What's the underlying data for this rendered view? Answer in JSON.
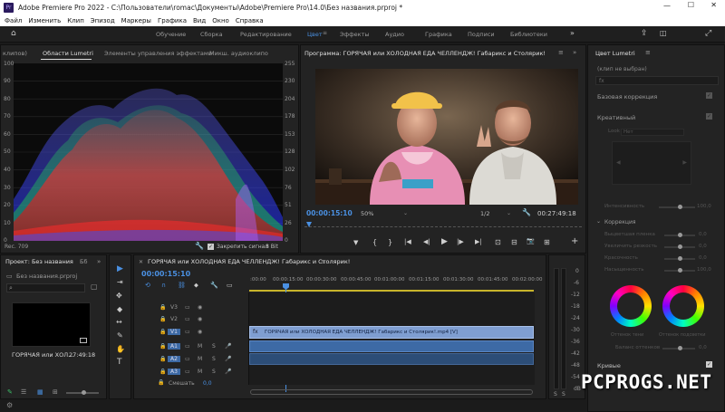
{
  "window": {
    "title": "Adobe Premiere Pro 2022 - C:\\Пользователи\\romac\\Документы\\Adobe\\Premiere Pro\\14.0\\Без названия.prproj *",
    "controls": [
      "—",
      "☐",
      "✕"
    ]
  },
  "menu": [
    "Файл",
    "Изменить",
    "Клип",
    "Эпизод",
    "Маркеры",
    "Графика",
    "Вид",
    "Окно",
    "Справка"
  ],
  "workspaces": {
    "items": [
      "Обучение",
      "Сборка",
      "Редактирование",
      "Цвет",
      "Эффекты",
      "Аудио",
      "Графика",
      "Подписи",
      "Библиотеки"
    ],
    "active": "Цвет"
  },
  "scopes": {
    "tabs": [
      "клипов)",
      "Области Lumetri",
      "Элементы управления эффектами",
      "Микш. аудиоклипо"
    ],
    "left_scale": [
      "100",
      "90",
      "80",
      "70",
      "60",
      "50",
      "40",
      "30",
      "20",
      "10",
      "0"
    ],
    "right_scale": [
      "255",
      "230",
      "204",
      "178",
      "153",
      "128",
      "102",
      "76",
      "51",
      "26",
      "0"
    ],
    "footer_left": "Rec. 709",
    "clamp_label": "Закрепить сигнал",
    "bit_depth": "8 Bit"
  },
  "program": {
    "title": "Программа: ГОРЯЧАЯ или ХОЛОДНАЯ ЕДА ЧЕЛЛЕНДЖ! Габарикс и Столярик!",
    "timecode": "00:00:15:10",
    "zoom": "50%",
    "resolution": "1/2",
    "duration": "00:27:49:18",
    "buttons": [
      "▼",
      "{",
      "}",
      "|◀",
      "◀|",
      "▶",
      "|▶",
      "▶|",
      "⊡",
      "⊟",
      "📷",
      "⊞",
      "+"
    ]
  },
  "project": {
    "tab": "Проект: Без названия",
    "tab2": "Бб",
    "file": "Без названия.prproj",
    "clip_name": "ГОРЯЧАЯ или ХОЛ...",
    "clip_duration": "27:49:18"
  },
  "tools": [
    "▶",
    "⇥",
    "✥",
    "◆",
    "↔",
    "✎",
    "✋",
    "T"
  ],
  "timeline": {
    "title": "ГОРЯЧАЯ или ХОЛОДНАЯ ЕДА ЧЕЛЛЕНДЖ! Габарикс и Столярик!",
    "timecode": "00:00:15:10",
    "ruler": [
      ":00:00",
      "00:00:15:00",
      "00:00:30:00",
      "00:00:45:00",
      "00:01:00:00",
      "00:01:15:00",
      "00:01:30:00",
      "00:01:45:00",
      "00:02:00:00"
    ],
    "video_tracks": [
      "V3",
      "V2",
      "V1"
    ],
    "audio_tracks": [
      "A1",
      "A2",
      "A3"
    ],
    "mix_label": "Смешать",
    "mix_value": "0,0",
    "clip_label": "ГОРЯЧАЯ или ХОЛОДНАЯ ЕДА ЧЕЛЛЕНДЖ! Габарикс и Столярик!.mp4 [V]"
  },
  "meter": {
    "scale": [
      "0",
      "-6",
      "-12",
      "-18",
      "-24",
      "-30",
      "-36",
      "-42",
      "-48",
      "-54",
      "dB"
    ]
  },
  "lumetri": {
    "title": "Цвет Lumetri",
    "no_clip": "(клип не выбран)",
    "basic": "Базовая коррекция",
    "creative": "Креативный",
    "look_label": "Look",
    "look_value": "Нет",
    "intensity_label": "Интенсивность",
    "intensity_value": "100,0",
    "correction": "Коррекция",
    "rows": [
      {
        "label": "Выцветшая пленка",
        "value": "0,0"
      },
      {
        "label": "Увеличить резкость",
        "value": "0,0"
      },
      {
        "label": "Красочность",
        "value": "0,0"
      },
      {
        "label": "Насыщенность",
        "value": "100,0"
      }
    ],
    "wheel1": "Оттенок тени",
    "wheel2": "Оттенок подсветки",
    "balance_label": "Баланс оттенков",
    "balance_value": "0,0",
    "curves": "Кривые",
    "watermark": "PCPROGS.NET"
  },
  "colors": {
    "accent": "#4a90e2",
    "clip_video": "#7f9ed1",
    "clip_audio": "#3d6aa5"
  }
}
